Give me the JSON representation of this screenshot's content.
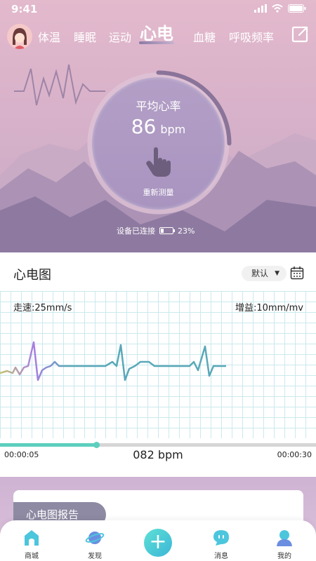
{
  "status_bar": {
    "time": "9:41"
  },
  "tabs": [
    {
      "label": "体温"
    },
    {
      "label": "睡眠"
    },
    {
      "label": "运动"
    },
    {
      "label": "心电",
      "active": true
    },
    {
      "label": "血糖"
    },
    {
      "label": "呼吸频率"
    }
  ],
  "measure": {
    "title": "平均心率",
    "value": "86",
    "unit": "bpm",
    "remeasure_label": "重新测量"
  },
  "device": {
    "status": "设备已连接",
    "battery": "23%",
    "battery_level": 0.23
  },
  "ecg": {
    "title": "心电图",
    "select_value": "默认",
    "speed": "走速:25mm/s",
    "gain": "增益:10mm/mv",
    "start_time": "00:00:05",
    "bpm": "082 bpm",
    "end_time": "00:00:30",
    "progress": 0.305
  },
  "report": {
    "tag": "心电图报告"
  },
  "nav": [
    {
      "label": "商城"
    },
    {
      "label": "发现"
    },
    {
      "label": "消息"
    },
    {
      "label": "我的"
    }
  ],
  "colors": {
    "accent": "#5ccfbf",
    "hero_bg": "#e3b9cc",
    "circle_bg": "#b39fc6"
  },
  "icons": {
    "status": [
      "signal-icon",
      "wifi-icon",
      "battery-icon"
    ],
    "share": "share-icon",
    "tap": "tap-icon",
    "calendar": "calendar-icon",
    "nav": [
      "shop-icon",
      "discover-icon",
      "add-icon",
      "message-icon",
      "profile-icon"
    ]
  }
}
